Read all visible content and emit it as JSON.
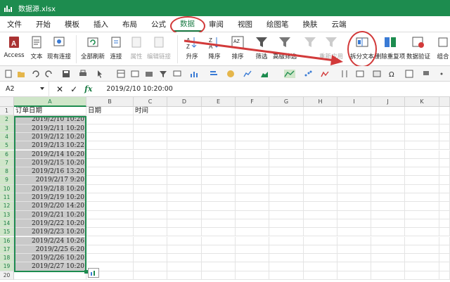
{
  "titlebar": {
    "filename": "数据源.xlsx"
  },
  "menu": [
    "文件",
    "开始",
    "模板",
    "插入",
    "布局",
    "公式",
    "数据",
    "审阅",
    "视图",
    "绘图笔",
    "换肤",
    "云端"
  ],
  "ribbon": {
    "access": "Access",
    "text": "文本",
    "existing": "现有连接",
    "refresh_all": "全部刷新",
    "connections": "连接",
    "properties": "属性",
    "edit_links": "编辑链接",
    "sort_asc": "升序",
    "sort_desc": "降序",
    "sort": "排序",
    "filter": "筛选",
    "advanced_filter": "高级筛选",
    "reapply": "重新应用",
    "split_text": "拆分文本",
    "remove_duplicates": "删除重复项",
    "data_validation": "数据验证",
    "group": "组合"
  },
  "formula_bar": {
    "name_box": "A2",
    "fx": "fx",
    "value": "2019/2/10 10:20:00"
  },
  "columns": [
    "A",
    "B",
    "C",
    "D",
    "E",
    "F",
    "G",
    "H",
    "I",
    "J",
    "K"
  ],
  "header_row": {
    "a": "订单日期",
    "b": "日期",
    "c": "时间"
  },
  "rows": [
    "2019/2/10 10:20",
    "2019/2/11 10:20",
    "2019/2/12 10:20",
    "2019/2/13 10:22",
    "2019/2/14 10:20",
    "2019/2/15 10:20",
    "2019/2/16 13:20",
    "2019/2/17 9:20",
    "2019/2/18 10:20",
    "2019/2/19 10:20",
    "2019/2/20 14:20",
    "2019/2/21 10:20",
    "2019/2/22 10:20",
    "2019/2/23 10:20",
    "2019/2/24 10:26",
    "2019/2/25 6:20",
    "2019/2/26 10:20",
    "2019/2/27 10:20"
  ],
  "colors": {
    "brand": "#1d8c4f",
    "annotation": "#d23a3a",
    "selection_fill": "#c9c9c9"
  }
}
